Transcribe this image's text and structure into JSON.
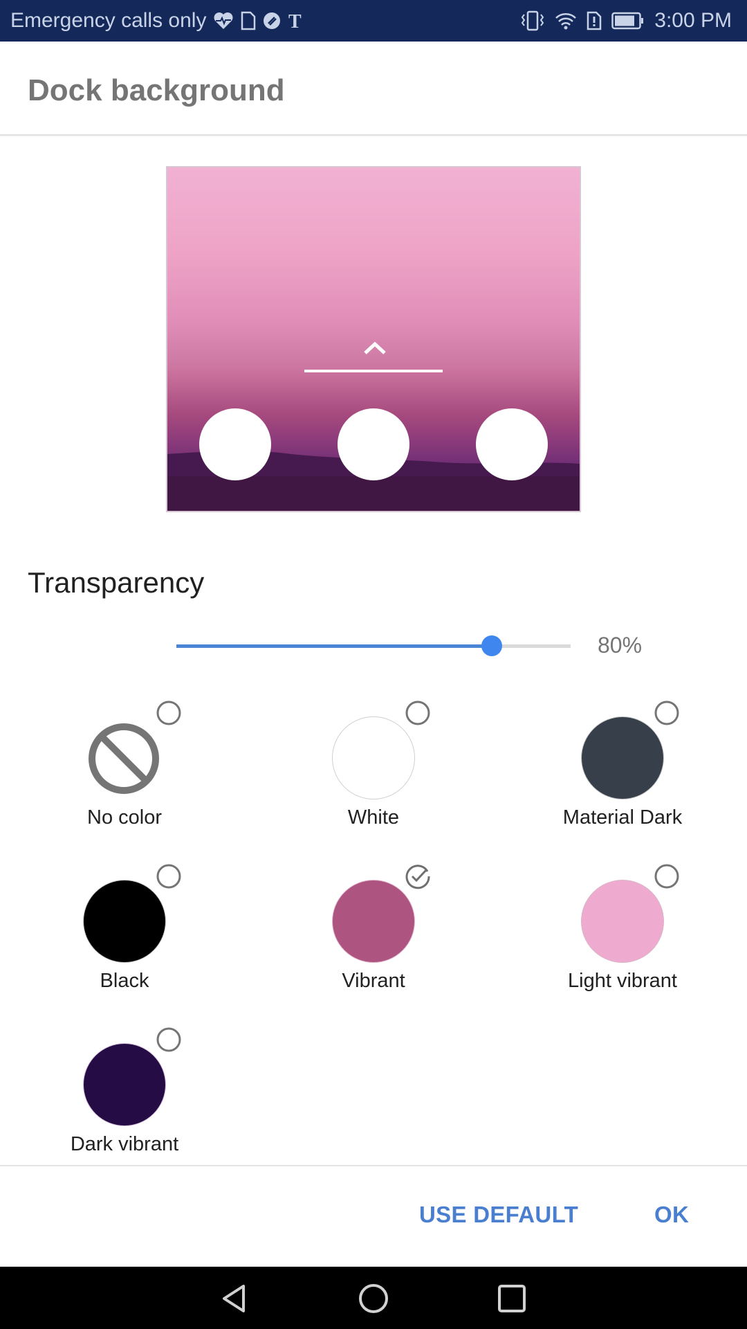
{
  "status_bar": {
    "carrier_text": "Emergency calls only",
    "left_icons": [
      "health-heart-icon",
      "document-icon",
      "app-circle-icon",
      "nytimes-icon"
    ],
    "right_icons": [
      "vibrate-icon",
      "wifi-icon",
      "sim-alert-icon",
      "battery-icon"
    ],
    "time": "3:00 PM",
    "background_color": "#14295a"
  },
  "dialog": {
    "title": "Dock background",
    "preview": {
      "dock_icon_count": 3
    },
    "transparency": {
      "label": "Transparency",
      "value_percent": 80,
      "value_label": "80%",
      "accent_color": "#3f86ef"
    },
    "swatches": [
      {
        "label": "No color",
        "color": null,
        "icon": "no-color-icon",
        "selected": false
      },
      {
        "label": "White",
        "color": "#ffffff",
        "selected": false
      },
      {
        "label": "Material Dark",
        "color": "#37404a",
        "selected": false
      },
      {
        "label": "Black",
        "color": "#000000",
        "selected": false
      },
      {
        "label": "Vibrant",
        "color": "#ae5480",
        "selected": true
      },
      {
        "label": "Light vibrant",
        "color": "#efabcf",
        "selected": false
      },
      {
        "label": "Dark vibrant",
        "color": "#250c45",
        "selected": false
      }
    ],
    "buttons": {
      "use_default": "USE DEFAULT",
      "ok": "OK",
      "color": "#4a7fd0"
    }
  },
  "nav_bar": {
    "buttons": [
      "back-icon",
      "home-icon",
      "recents-icon"
    ]
  }
}
